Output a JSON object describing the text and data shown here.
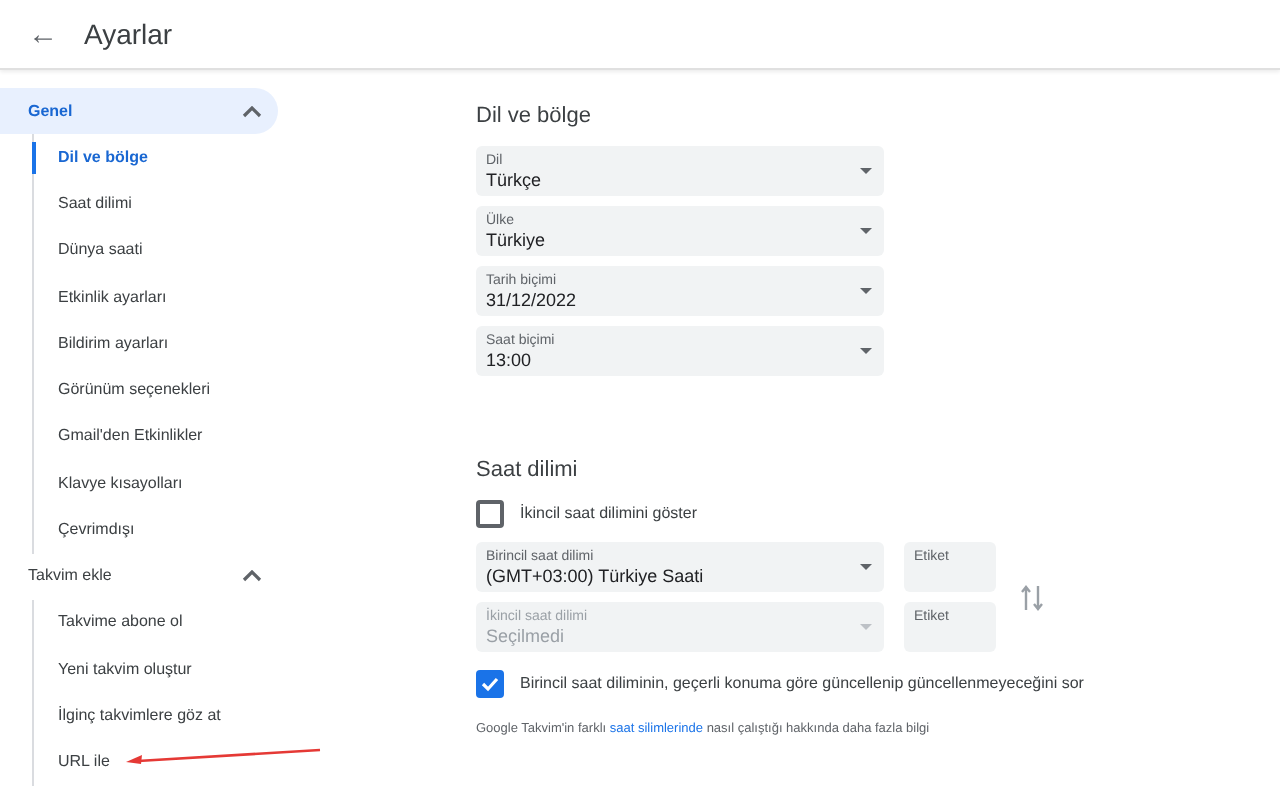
{
  "header": {
    "back": "←",
    "title": "Ayarlar"
  },
  "sidebar": [
    {
      "label": "Genel",
      "selected": true,
      "expanded": true,
      "children": [
        {
          "label": "Dil ve bölge",
          "selected": true
        },
        {
          "label": "Saat dilimi",
          "selected": false
        },
        {
          "label": "Dünya saati",
          "selected": false
        },
        {
          "label": "Etkinlik ayarları",
          "selected": false
        },
        {
          "label": "Bildirim ayarları",
          "selected": false
        },
        {
          "label": "Görünüm seçenekleri",
          "selected": false
        },
        {
          "label": "Gmail'den Etkinlikler",
          "selected": false
        },
        {
          "label": "Klavye kısayolları",
          "selected": false
        },
        {
          "label": "Çevrimdışı",
          "selected": false
        }
      ]
    },
    {
      "label": "Takvim ekle",
      "selected": false,
      "expanded": true,
      "children": [
        {
          "label": "Takvime abone ol",
          "selected": false
        },
        {
          "label": "Yeni takvim oluştur",
          "selected": false
        },
        {
          "label": "İlginç takvimlere göz at",
          "selected": false
        },
        {
          "label": "URL ile",
          "selected": false,
          "annotated": true
        }
      ]
    }
  ],
  "language_section": {
    "title": "Dil ve bölge",
    "selects": [
      {
        "label": "Dil",
        "value": "Türkçe"
      },
      {
        "label": "Ülke",
        "value": "Türkiye"
      },
      {
        "label": "Tarih biçimi",
        "value": "31/12/2022"
      },
      {
        "label": "Saat biçimi",
        "value": "13:00"
      }
    ]
  },
  "timezone_section": {
    "title": "Saat dilimi",
    "secondary_toggle": {
      "label": "İkincil saat dilimini göster",
      "checked": false
    },
    "zones": [
      {
        "label": "Birincil saat dilimi",
        "value": "(GMT+03:00) Türkiye Saati",
        "disabled": false,
        "tag_placeholder": "Etiket"
      },
      {
        "label": "İkincil saat dilimi",
        "value": "Seçilmedi",
        "disabled": true,
        "tag_placeholder": "Etiket"
      }
    ],
    "ask_update": {
      "label": "Birincil saat diliminin, geçerli konuma göre güncellenip güncellenmeyeceğini sor",
      "checked": true
    },
    "note": {
      "before": "Google Takvim'in farklı",
      "link": "saat silimlerinde",
      "after": "nasıl çalıştığı hakkında daha fazla bilgi"
    }
  }
}
